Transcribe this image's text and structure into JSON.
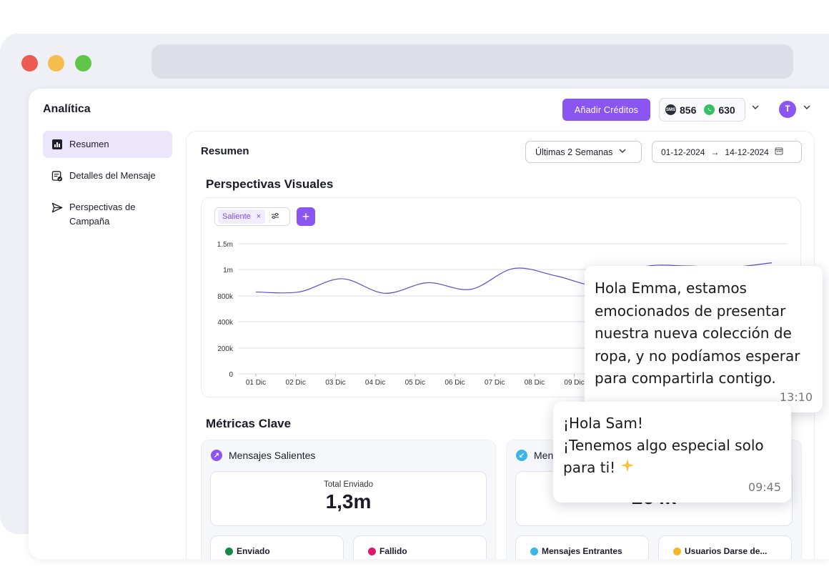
{
  "app": {
    "title": "Analítica",
    "credits_button": "Añadir Créditos",
    "sms_icon_label": "SMS",
    "sms_balance": "856",
    "whatsapp_balance": "630",
    "avatar_initial": "T"
  },
  "sidebar": {
    "items": [
      {
        "label": "Resumen",
        "icon": "bar-chart-icon",
        "active": true
      },
      {
        "label": "Detalles del Mensaje",
        "icon": "message-details-icon",
        "active": false
      },
      {
        "label": "Perspectivas de Campaña",
        "icon": "send-icon",
        "active": false
      }
    ]
  },
  "main": {
    "title": "Resumen",
    "range_select": "Últimas 2 Semanas",
    "date_from": "01-12-2024",
    "date_arrow": "→",
    "date_to": "14-12-2024"
  },
  "visual": {
    "title": "Perspectivas Visuales",
    "filter_chip": "Saliente",
    "chip_close": "×",
    "add_label": "+"
  },
  "chart_data": {
    "type": "line",
    "x": [
      "01 Dic",
      "02 Dic",
      "03 Dic",
      "04 Dic",
      "05 Dic",
      "06 Dic",
      "07 Dic",
      "08 Dic",
      "09 Dic"
    ],
    "y_ticks": [
      "0",
      "200k",
      "400k",
      "800k",
      "1m",
      "1.5m"
    ],
    "series": [
      {
        "values": [
          830000,
          830000,
          930000,
          820000,
          900000,
          850000,
          1020000,
          950000,
          880000,
          1050000,
          1070000,
          1040000,
          1130000
        ]
      }
    ],
    "color": "#5b4bd6",
    "grid": true
  },
  "metrics": {
    "title": "Métricas Clave",
    "outgoing": {
      "title": "Mensajes Salientes",
      "total_label": "Total Enviado",
      "total_value": "1,3m",
      "sub1": "Enviado",
      "sub2": "Fallido",
      "sub1_color": "#178a4a",
      "sub2_color": "#e0176f"
    },
    "incoming": {
      "title": "Men",
      "total_value": "264k",
      "sub1": "Mensajes Entrantes",
      "sub2": "Usuarios Darse de...",
      "sub1_color": "#3bb4e6",
      "sub2_color": "#f5b62a"
    }
  },
  "bubbles": [
    {
      "text": "Hola Emma, estamos\nemocionados de presentar\nnuestra nueva colección de\nropa, y no podíamos esperar\npara compartirla contigo.",
      "time": "13:10"
    },
    {
      "text": "¡Hola Sam!\n¡Tenemos algo especial solo\npara ti!",
      "time": "09:45"
    }
  ]
}
